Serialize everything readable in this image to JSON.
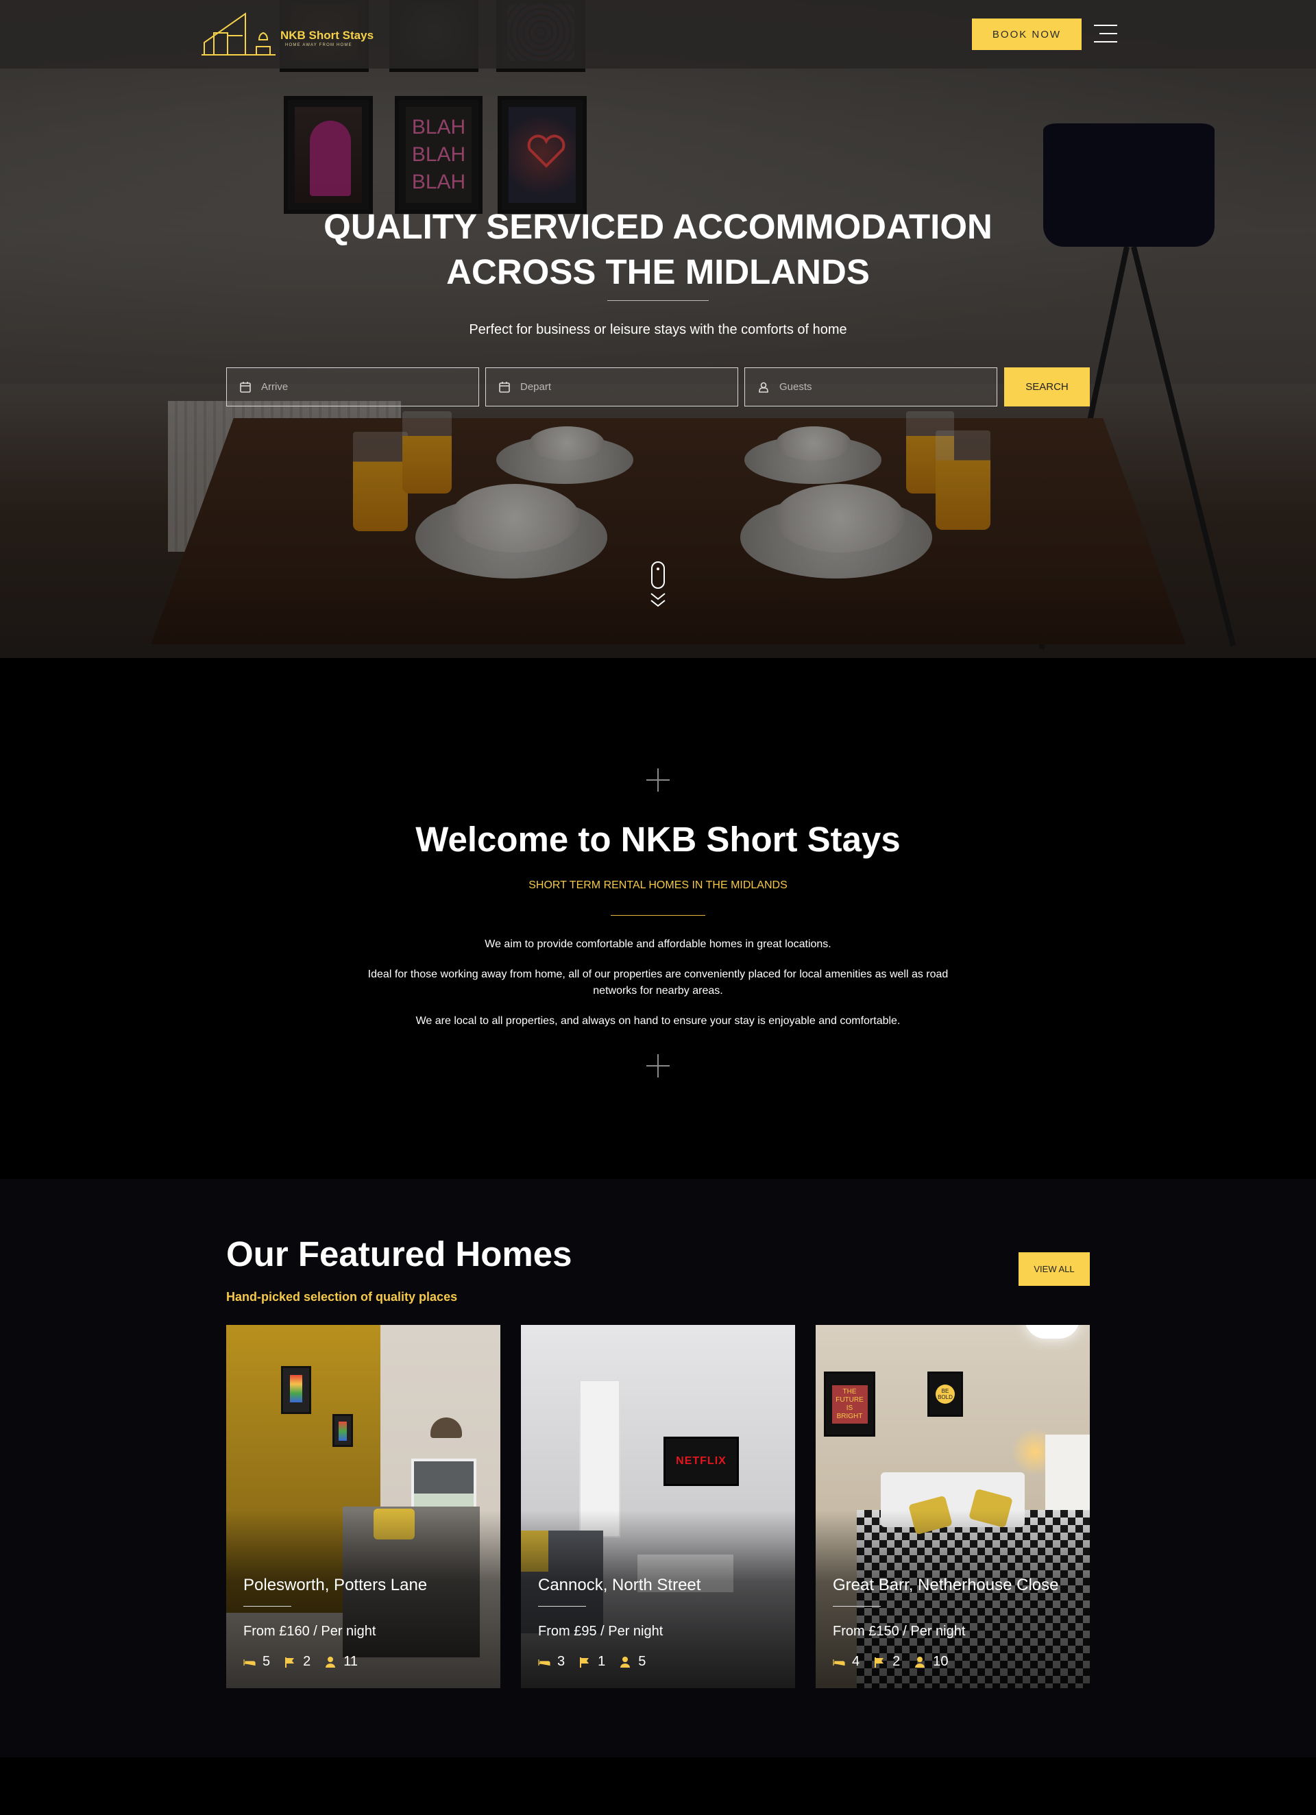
{
  "brand": {
    "name": "NKB Short Stays",
    "tagline": "HOME AWAY FROM HOME",
    "accent": "#fbd24e"
  },
  "nav": {
    "book_label": "BOOK NOW",
    "menu_icon": "hamburger-menu-icon"
  },
  "hero": {
    "title_line1": "QUALITY SERVICED ACCOMMODATION",
    "title_line2": "ACROSS THE MIDLANDS",
    "subtitle": "Perfect for business or leisure stays with the comforts of home",
    "frame_texts": [
      "BLAH",
      "BLAH",
      "BLAH"
    ],
    "search": {
      "arrive_placeholder": "Arrive",
      "depart_placeholder": "Depart",
      "guests_placeholder": "Guests",
      "search_label": "SEARCH"
    }
  },
  "welcome": {
    "title": "Welcome to NKB Short Stays",
    "subtitle": "SHORT TERM RENTAL HOMES IN THE MIDLANDS",
    "paragraphs": [
      "We aim to provide comfortable and affordable homes in great locations.",
      "Ideal for those working away from home, all of our properties are conveniently placed for local amenities as well as road networks for nearby areas.",
      "We are local to all properties, and always on hand to ensure your stay is enjoyable and comfortable."
    ]
  },
  "featured": {
    "title": "Our Featured Homes",
    "subtitle": "Hand-picked selection of quality places",
    "view_all_label": "VIEW ALL",
    "homes": [
      {
        "name": "Polesworth, Potters Lane",
        "price": "From £160 / Per night",
        "beds": "5",
        "baths": "2",
        "guests": "11"
      },
      {
        "name": "Cannock, North Street",
        "price": "From £95 / Per night",
        "beds": "3",
        "baths": "1",
        "guests": "5",
        "tv_text": "NETFLIX"
      },
      {
        "name": "Great Barr, Netherhouse Close",
        "price": "From £150 / Per night",
        "beds": "4",
        "baths": "2",
        "guests": "10",
        "poster1": "THE FUTURE IS BRIGHT",
        "poster2": "BE BOLD"
      }
    ]
  }
}
